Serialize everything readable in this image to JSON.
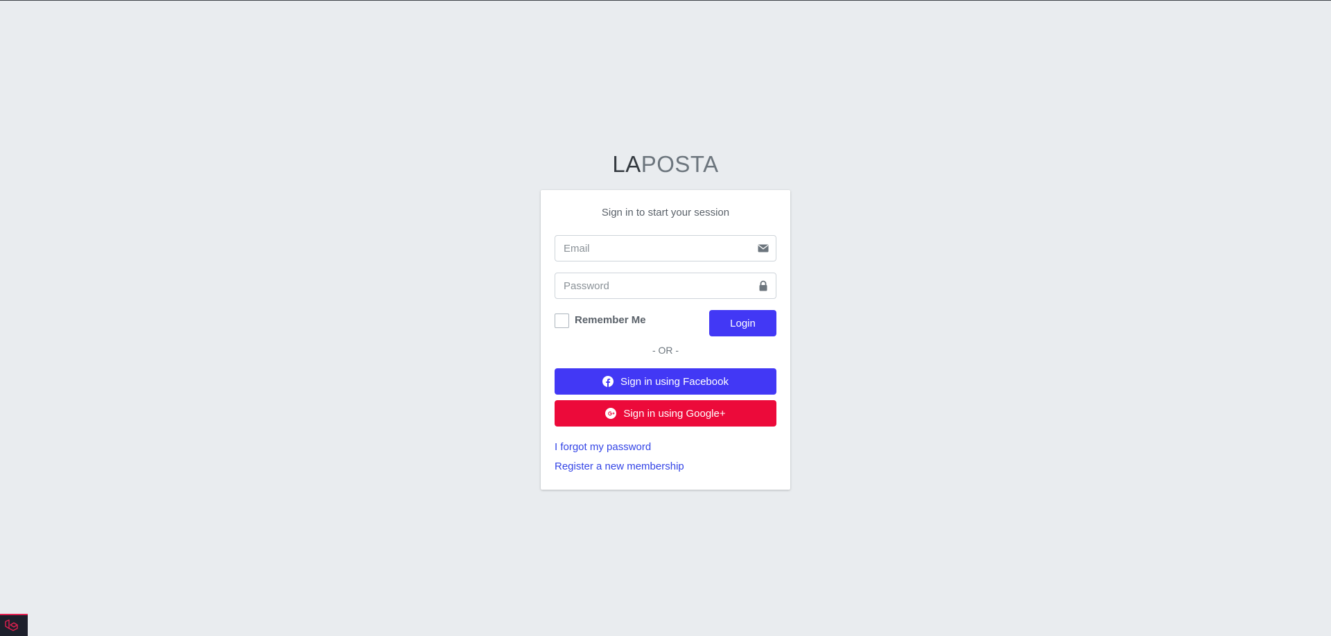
{
  "app": {
    "logo_bold": "LA",
    "logo_light": "POSTA"
  },
  "login": {
    "message": "Sign in to start your session",
    "email_placeholder": "Email",
    "email_value": "",
    "password_placeholder": "Password",
    "password_value": "",
    "remember_label": "Remember Me",
    "remember_checked": false,
    "login_button": "Login",
    "or_text": "- OR -",
    "facebook_button": "Sign in using Facebook",
    "google_button": "Sign in using Google+",
    "forgot_link": "I forgot my password",
    "register_link": "Register a new membership"
  },
  "icons": {
    "email": "envelope-icon",
    "password": "lock-icon",
    "facebook": "facebook-icon",
    "google": "google-plus-icon",
    "debugbar": "laravel-icon"
  },
  "colors": {
    "primary": "#4238f5",
    "google": "#ec0a3a",
    "link": "#3344e6",
    "background": "#e9ecef"
  }
}
